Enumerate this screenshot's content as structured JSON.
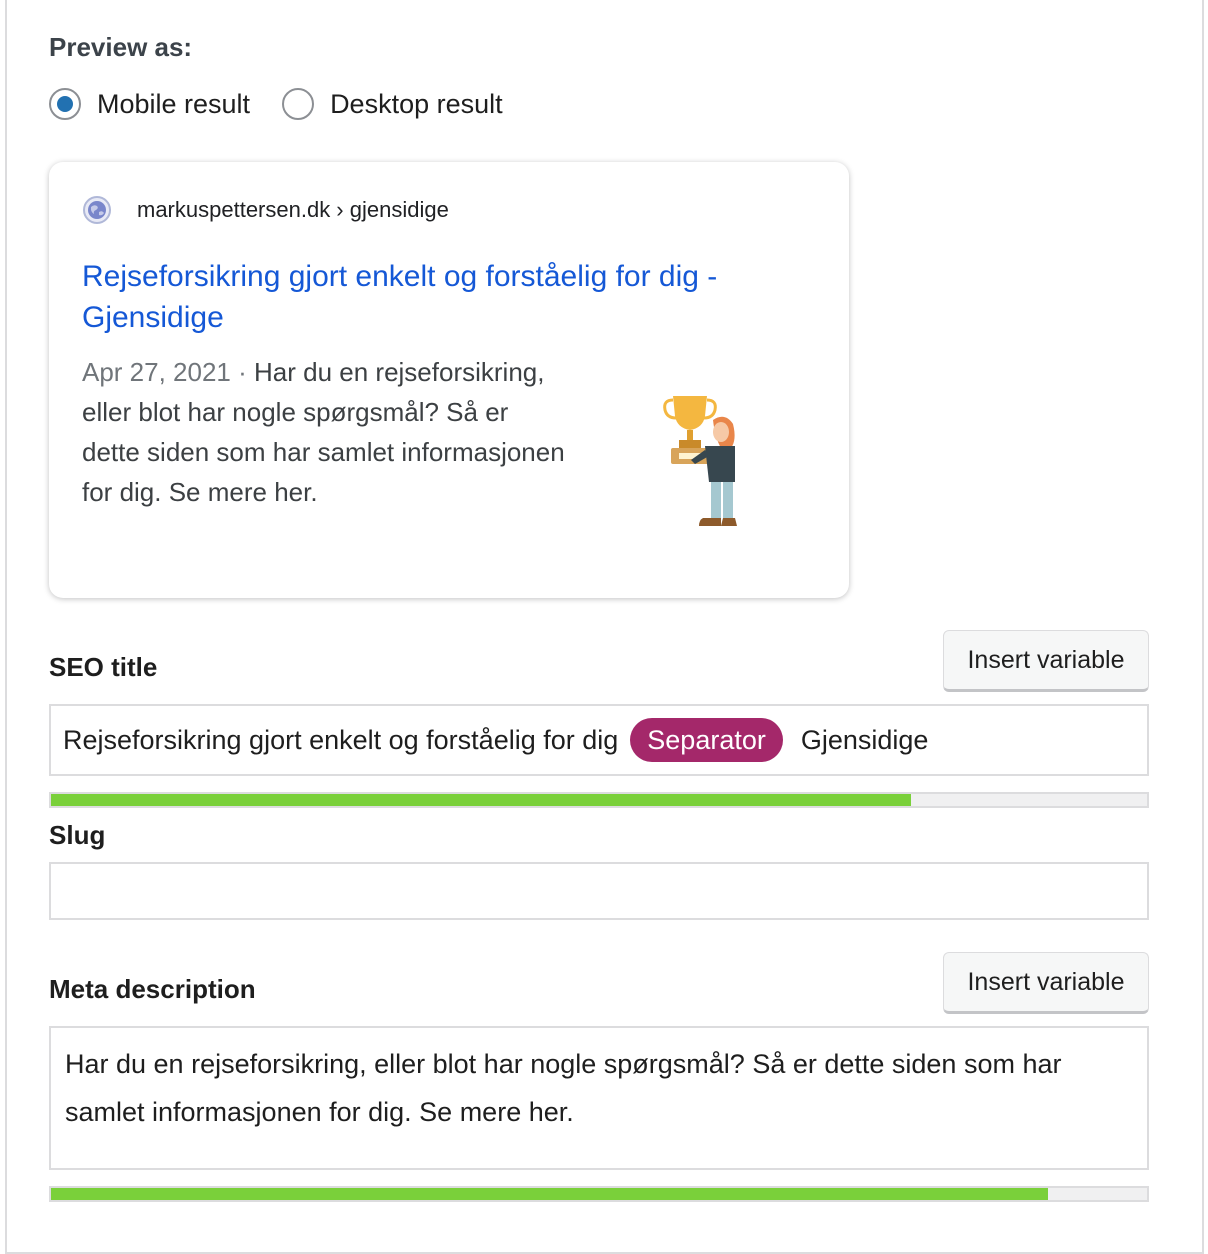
{
  "preview": {
    "label": "Preview as:",
    "options": [
      {
        "label": "Mobile result",
        "checked": true
      },
      {
        "label": "Desktop result",
        "checked": false
      }
    ]
  },
  "serp": {
    "url": "markuspettersen.dk › gjensidige",
    "title": "Rejseforsikring gjort enkelt og forståelig for dig - Gjensidige",
    "date": "Apr 27, 2021",
    "date_sep": " · ",
    "description": "Har du en rejseforsikring, eller blot har nogle spørgsmål? Så er dette siden som har samlet informasjonen for dig. Se mere her."
  },
  "seo_title": {
    "label": "SEO title",
    "insert_label": "Insert variable",
    "text_before": "Rejseforsikring gjort enkelt og forståelig for dig",
    "separator_label": "Separator",
    "text_after": "Gjensidige",
    "progress": 0.785
  },
  "slug": {
    "label": "Slug",
    "value": ""
  },
  "meta": {
    "label": "Meta description",
    "insert_label": "Insert variable",
    "value": "Har du en rejseforsikring, eller blot har nogle spørgsmål? Så er dette siden som har samlet informasjonen for dig. Se mere her.",
    "progress": 0.91
  },
  "colors": {
    "accent": "#2271b1",
    "serp_link": "#1558d6",
    "separator": "#a4286a",
    "progress_good": "#7ad03a"
  }
}
